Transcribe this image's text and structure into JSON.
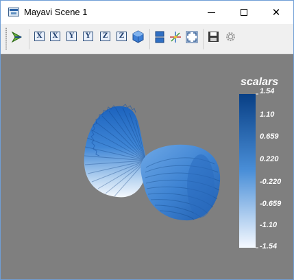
{
  "window": {
    "title": "Mayavi Scene 1",
    "app_icon": "mayavi-window-icon",
    "controls": [
      "minimize-icon",
      "maximize-icon",
      "close-icon"
    ],
    "close_glyph": "✕"
  },
  "toolbar": {
    "buttons": [
      {
        "name": "mayavi-pipeline-button",
        "icon": "pipeline-icon"
      },
      {
        "name": "view-x-positive-button",
        "icon": "x-axis-icon",
        "label": "X"
      },
      {
        "name": "view-x-negative-button",
        "icon": "x-axis-icon",
        "label": "X"
      },
      {
        "name": "view-y-positive-button",
        "icon": "y-axis-icon",
        "label": "Y"
      },
      {
        "name": "view-y-negative-button",
        "icon": "y-axis-icon",
        "label": "Y"
      },
      {
        "name": "view-z-positive-button",
        "icon": "z-axis-icon",
        "label": "Z"
      },
      {
        "name": "view-z-negative-button",
        "icon": "z-axis-icon",
        "label": "Z"
      },
      {
        "name": "isometric-view-button",
        "icon": "cube-icon"
      },
      {
        "name": "toggle-parallel-projection-button",
        "icon": "parallel-projection-icon"
      },
      {
        "name": "toggle-axes-indicator-button",
        "icon": "axes-indicator-icon"
      },
      {
        "name": "fullscreen-button",
        "icon": "fullscreen-icon"
      },
      {
        "name": "save-snapshot-button",
        "icon": "floppy-disk-icon"
      },
      {
        "name": "scene-settings-button",
        "icon": "gear-icon"
      }
    ]
  },
  "scene": {
    "background_color": "#7f7f7f"
  },
  "colorbar": {
    "title": "scalars",
    "labels": [
      "1.54",
      "1.10",
      "0.659",
      "0.220",
      "-0.220",
      "-0.659",
      "-1.10",
      "-1.54"
    ],
    "range": [
      -1.54,
      1.54
    ],
    "colors": {
      "top": "#083f85",
      "bottom": "#f5f9ff"
    }
  }
}
